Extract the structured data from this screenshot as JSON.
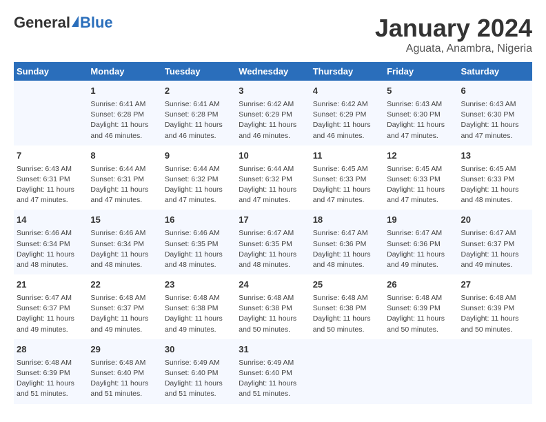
{
  "logo": {
    "general": "General",
    "blue": "Blue"
  },
  "header": {
    "month": "January 2024",
    "location": "Aguata, Anambra, Nigeria"
  },
  "days_of_week": [
    "Sunday",
    "Monday",
    "Tuesday",
    "Wednesday",
    "Thursday",
    "Friday",
    "Saturday"
  ],
  "weeks": [
    [
      {
        "day": "",
        "info": ""
      },
      {
        "day": "1",
        "info": "Sunrise: 6:41 AM\nSunset: 6:28 PM\nDaylight: 11 hours\nand 46 minutes."
      },
      {
        "day": "2",
        "info": "Sunrise: 6:41 AM\nSunset: 6:28 PM\nDaylight: 11 hours\nand 46 minutes."
      },
      {
        "day": "3",
        "info": "Sunrise: 6:42 AM\nSunset: 6:29 PM\nDaylight: 11 hours\nand 46 minutes."
      },
      {
        "day": "4",
        "info": "Sunrise: 6:42 AM\nSunset: 6:29 PM\nDaylight: 11 hours\nand 46 minutes."
      },
      {
        "day": "5",
        "info": "Sunrise: 6:43 AM\nSunset: 6:30 PM\nDaylight: 11 hours\nand 47 minutes."
      },
      {
        "day": "6",
        "info": "Sunrise: 6:43 AM\nSunset: 6:30 PM\nDaylight: 11 hours\nand 47 minutes."
      }
    ],
    [
      {
        "day": "7",
        "info": "Sunrise: 6:43 AM\nSunset: 6:31 PM\nDaylight: 11 hours\nand 47 minutes."
      },
      {
        "day": "8",
        "info": "Sunrise: 6:44 AM\nSunset: 6:31 PM\nDaylight: 11 hours\nand 47 minutes."
      },
      {
        "day": "9",
        "info": "Sunrise: 6:44 AM\nSunset: 6:32 PM\nDaylight: 11 hours\nand 47 minutes."
      },
      {
        "day": "10",
        "info": "Sunrise: 6:44 AM\nSunset: 6:32 PM\nDaylight: 11 hours\nand 47 minutes."
      },
      {
        "day": "11",
        "info": "Sunrise: 6:45 AM\nSunset: 6:33 PM\nDaylight: 11 hours\nand 47 minutes."
      },
      {
        "day": "12",
        "info": "Sunrise: 6:45 AM\nSunset: 6:33 PM\nDaylight: 11 hours\nand 47 minutes."
      },
      {
        "day": "13",
        "info": "Sunrise: 6:45 AM\nSunset: 6:33 PM\nDaylight: 11 hours\nand 48 minutes."
      }
    ],
    [
      {
        "day": "14",
        "info": "Sunrise: 6:46 AM\nSunset: 6:34 PM\nDaylight: 11 hours\nand 48 minutes."
      },
      {
        "day": "15",
        "info": "Sunrise: 6:46 AM\nSunset: 6:34 PM\nDaylight: 11 hours\nand 48 minutes."
      },
      {
        "day": "16",
        "info": "Sunrise: 6:46 AM\nSunset: 6:35 PM\nDaylight: 11 hours\nand 48 minutes."
      },
      {
        "day": "17",
        "info": "Sunrise: 6:47 AM\nSunset: 6:35 PM\nDaylight: 11 hours\nand 48 minutes."
      },
      {
        "day": "18",
        "info": "Sunrise: 6:47 AM\nSunset: 6:36 PM\nDaylight: 11 hours\nand 48 minutes."
      },
      {
        "day": "19",
        "info": "Sunrise: 6:47 AM\nSunset: 6:36 PM\nDaylight: 11 hours\nand 49 minutes."
      },
      {
        "day": "20",
        "info": "Sunrise: 6:47 AM\nSunset: 6:37 PM\nDaylight: 11 hours\nand 49 minutes."
      }
    ],
    [
      {
        "day": "21",
        "info": "Sunrise: 6:47 AM\nSunset: 6:37 PM\nDaylight: 11 hours\nand 49 minutes."
      },
      {
        "day": "22",
        "info": "Sunrise: 6:48 AM\nSunset: 6:37 PM\nDaylight: 11 hours\nand 49 minutes."
      },
      {
        "day": "23",
        "info": "Sunrise: 6:48 AM\nSunset: 6:38 PM\nDaylight: 11 hours\nand 49 minutes."
      },
      {
        "day": "24",
        "info": "Sunrise: 6:48 AM\nSunset: 6:38 PM\nDaylight: 11 hours\nand 50 minutes."
      },
      {
        "day": "25",
        "info": "Sunrise: 6:48 AM\nSunset: 6:38 PM\nDaylight: 11 hours\nand 50 minutes."
      },
      {
        "day": "26",
        "info": "Sunrise: 6:48 AM\nSunset: 6:39 PM\nDaylight: 11 hours\nand 50 minutes."
      },
      {
        "day": "27",
        "info": "Sunrise: 6:48 AM\nSunset: 6:39 PM\nDaylight: 11 hours\nand 50 minutes."
      }
    ],
    [
      {
        "day": "28",
        "info": "Sunrise: 6:48 AM\nSunset: 6:39 PM\nDaylight: 11 hours\nand 51 minutes."
      },
      {
        "day": "29",
        "info": "Sunrise: 6:48 AM\nSunset: 6:40 PM\nDaylight: 11 hours\nand 51 minutes."
      },
      {
        "day": "30",
        "info": "Sunrise: 6:49 AM\nSunset: 6:40 PM\nDaylight: 11 hours\nand 51 minutes."
      },
      {
        "day": "31",
        "info": "Sunrise: 6:49 AM\nSunset: 6:40 PM\nDaylight: 11 hours\nand 51 minutes."
      },
      {
        "day": "",
        "info": ""
      },
      {
        "day": "",
        "info": ""
      },
      {
        "day": "",
        "info": ""
      }
    ]
  ]
}
